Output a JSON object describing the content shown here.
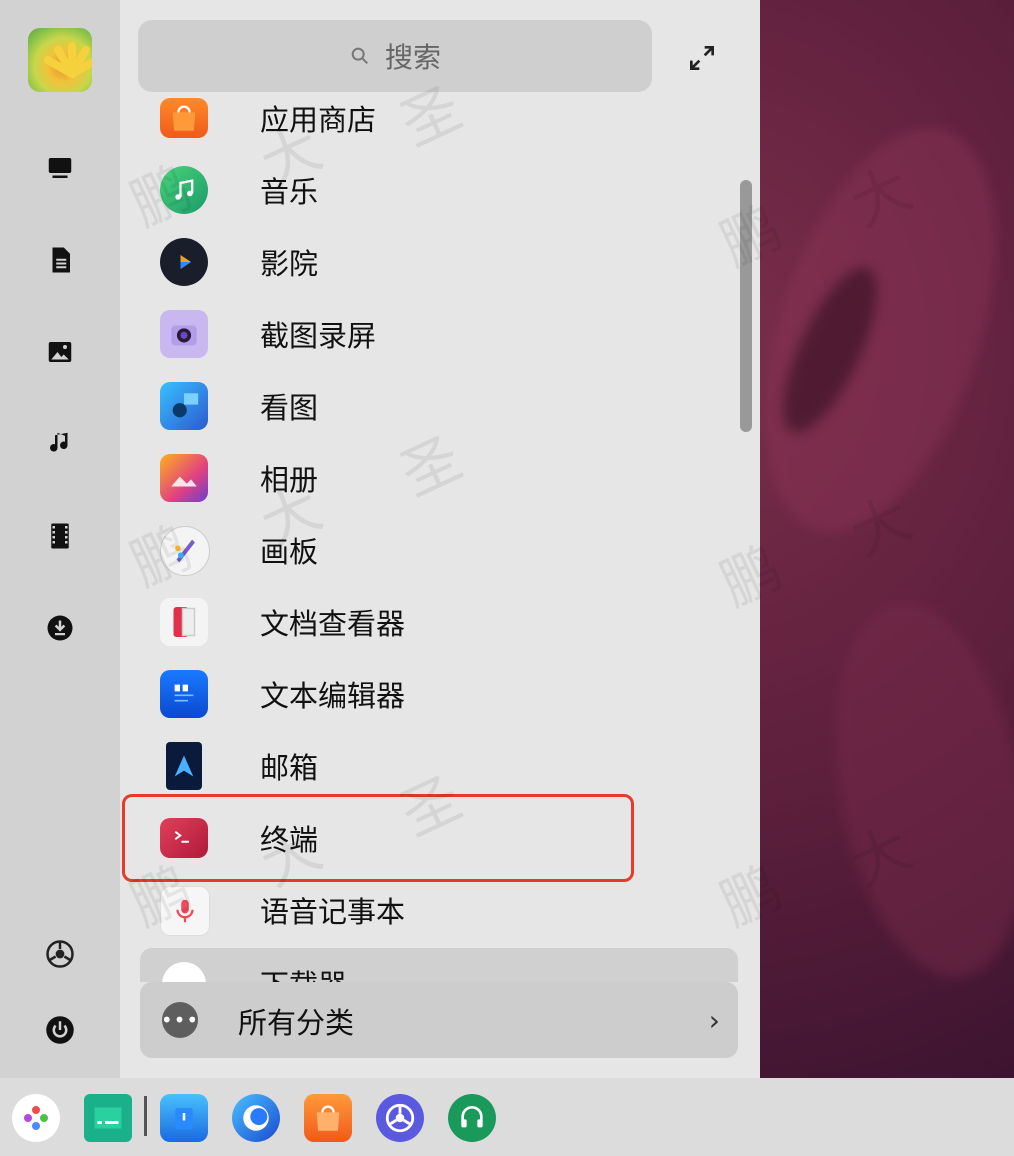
{
  "search": {
    "placeholder": "搜索"
  },
  "apps": [
    {
      "label": "应用商店",
      "icon": "app-store-icon"
    },
    {
      "label": "音乐",
      "icon": "music-app-icon"
    },
    {
      "label": "影院",
      "icon": "movie-app-icon"
    },
    {
      "label": "截图录屏",
      "icon": "screenshot-app-icon"
    },
    {
      "label": "看图",
      "icon": "image-viewer-icon"
    },
    {
      "label": "相册",
      "icon": "album-app-icon"
    },
    {
      "label": "画板",
      "icon": "draw-app-icon"
    },
    {
      "label": "文档查看器",
      "icon": "document-viewer-icon"
    },
    {
      "label": "文本编辑器",
      "icon": "text-editor-icon"
    },
    {
      "label": "邮箱",
      "icon": "mail-app-icon"
    },
    {
      "label": "终端",
      "icon": "terminal-app-icon"
    },
    {
      "label": "语音记事本",
      "icon": "voice-notes-icon"
    },
    {
      "label": "下载器",
      "icon": "downloader-icon"
    }
  ],
  "category": {
    "label": "所有分类",
    "more": "•••",
    "chevron": "›"
  },
  "watermark": [
    "鹏",
    "大",
    "圣"
  ],
  "colors": {
    "highlight": "#e63a2a",
    "terminal": "#c8264a"
  }
}
